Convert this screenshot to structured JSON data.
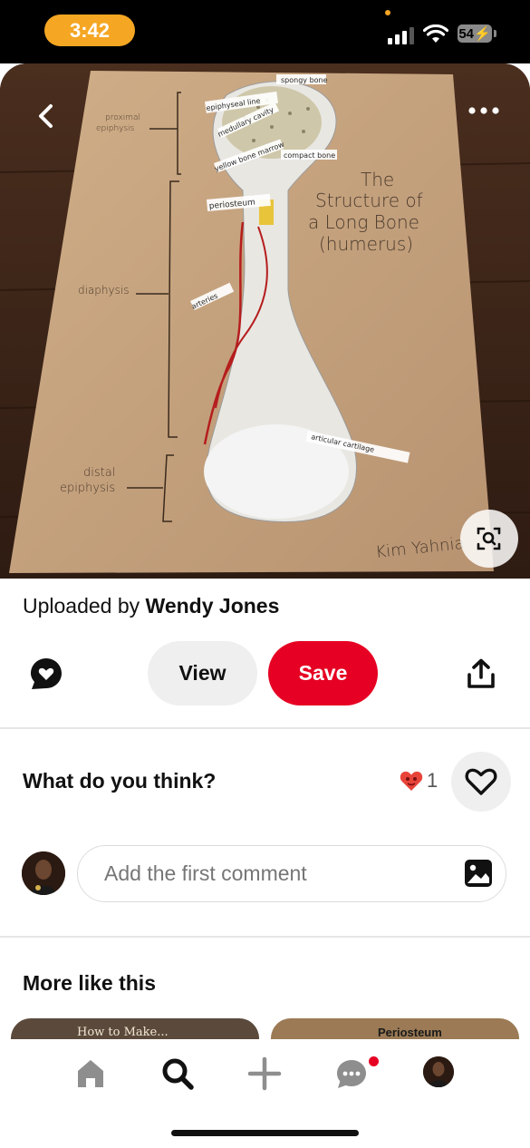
{
  "status_bar": {
    "time": "3:42",
    "battery": "54"
  },
  "pin_image": {
    "subject": "long bone model poster",
    "labels": {
      "title_line1": "The",
      "title_line2": "Structure of",
      "title_line3": "a Long Bone",
      "title_line4": "(humerus)",
      "proximal_line1": "proximal",
      "proximal_line2": "epiphysis",
      "diaphysis": "diaphysis",
      "distal_line1": "distal",
      "distal_line2": "epiphysis",
      "spongy": "spongy bone",
      "epiphyseal": "epiphyseal line",
      "medullary": "medullary cavity",
      "compact": "compact bone",
      "yellow_marrow": "yellow bone marrow",
      "periosteum": "periosteum",
      "arteries": "arteries",
      "articular": "articular cartilage",
      "signature": "Kim Yahnia"
    }
  },
  "pin": {
    "uploaded_prefix": "Uploaded by",
    "uploader": "Wendy Jones",
    "view_label": "View",
    "save_label": "Save"
  },
  "feedback": {
    "prompt": "What do you think?",
    "reaction_count": "1"
  },
  "comment": {
    "placeholder": "Add the first comment"
  },
  "more_like_this": {
    "heading": "More like this",
    "items": [
      {
        "caption": "How to Make..."
      },
      {
        "caption": "Periosteum"
      }
    ]
  },
  "colors": {
    "accent": "#e60023",
    "status_pill": "#f5a623",
    "button_gray": "#efefef"
  },
  "nav": [
    "home-icon",
    "search-icon",
    "plus-icon",
    "messages-icon",
    "profile-avatar"
  ]
}
